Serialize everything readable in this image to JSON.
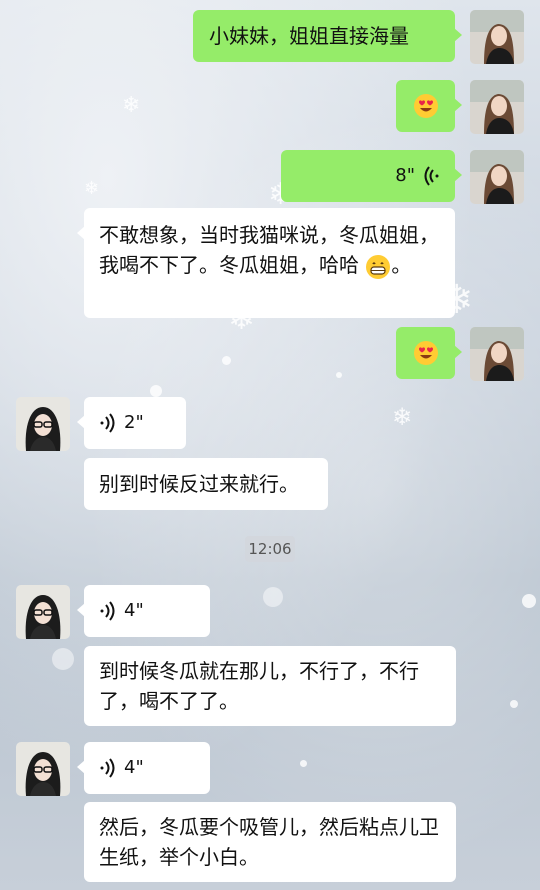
{
  "messages": [
    {
      "type": "text",
      "sender": "me",
      "text": "小妹妹，姐姐直接海量"
    },
    {
      "type": "emoji",
      "sender": "me",
      "icon": "heart-eyes-emoji"
    },
    {
      "type": "voice",
      "sender": "me",
      "duration": "8\""
    },
    {
      "type": "text",
      "sender": "other",
      "text_main": "不敢想象，当时我猫咪说，冬瓜姐姐，我喝不下了。冬瓜姐姐，哈哈",
      "text_after_emoji": "。",
      "inline_icon": "grinning-emoji"
    },
    {
      "type": "emoji",
      "sender": "me",
      "icon": "heart-eyes-emoji"
    },
    {
      "type": "voice",
      "sender": "other",
      "duration": "2\""
    },
    {
      "type": "text",
      "sender": "other",
      "text": "别到时候反过来就行。"
    },
    {
      "type": "timestamp",
      "text": "12:06"
    },
    {
      "type": "voice",
      "sender": "other",
      "duration": "4\""
    },
    {
      "type": "text",
      "sender": "other",
      "text": "到时候冬瓜就在那儿，不行了，不行了，喝不了了。"
    },
    {
      "type": "voice",
      "sender": "other",
      "duration": "4\""
    },
    {
      "type": "text",
      "sender": "other",
      "text": "然后，冬瓜要个吸管儿，然后粘点儿卫生纸，举个小白。"
    }
  ],
  "colors": {
    "me_bubble": "#95ec69",
    "other_bubble": "#ffffff"
  }
}
